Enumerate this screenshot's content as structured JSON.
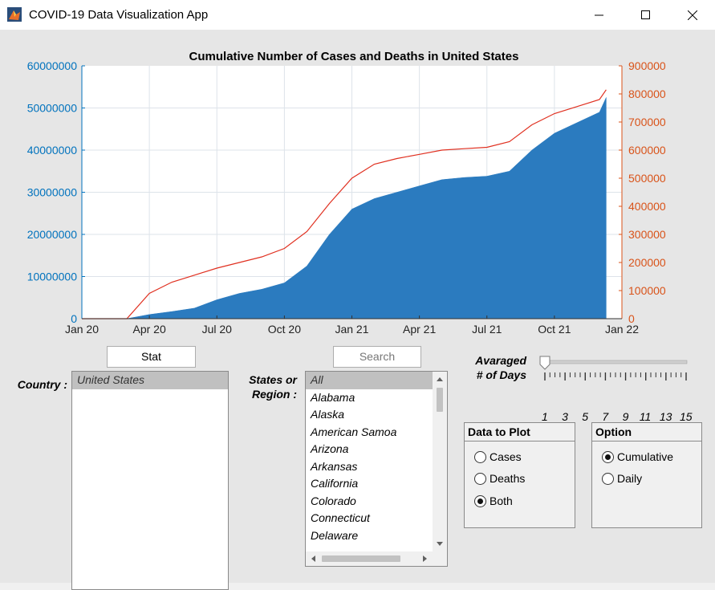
{
  "window": {
    "title": "COVID-19 Data Visualization App"
  },
  "colors": {
    "cases_bar": "#2b7bbf",
    "cases_axis": "#0072bd",
    "deaths_line": "#e03020",
    "deaths_axis": "#d95319"
  },
  "chart_data": {
    "type": "bar",
    "title": "Cumulative Number of Cases and Deaths in United States",
    "xlabel": "",
    "ylabel": "",
    "x_ticks": [
      "Jan 20",
      "Apr 20",
      "Jul 20",
      "Oct 20",
      "Jan 21",
      "Apr 21",
      "Jul 21",
      "Oct 21",
      "Jan 22"
    ],
    "y_left_ticks": [
      "0",
      "10000000",
      "20000000",
      "30000000",
      "40000000",
      "50000000",
      "60000000"
    ],
    "y_right_ticks": [
      "0",
      "100000",
      "200000",
      "300000",
      "400000",
      "500000",
      "600000",
      "700000",
      "800000",
      "900000"
    ],
    "ylim_left": [
      0,
      60000000
    ],
    "ylim_right": [
      0,
      900000
    ],
    "grid": true,
    "x_months_since": [
      0,
      2,
      3,
      4,
      5,
      6,
      7,
      8,
      9,
      10,
      11,
      12,
      13,
      14,
      15,
      16,
      17,
      18,
      19,
      20,
      21,
      22,
      23,
      23.3
    ],
    "series": [
      {
        "name": "Cases",
        "axis": "left",
        "values": [
          0,
          0,
          1000000,
          1700000,
          2500000,
          4500000,
          6000000,
          7000000,
          8500000,
          12500000,
          20000000,
          26000000,
          28500000,
          30000000,
          31500000,
          33000000,
          33500000,
          33800000,
          35000000,
          40000000,
          44000000,
          46500000,
          49000000,
          52500000
        ]
      },
      {
        "name": "Deaths",
        "axis": "right",
        "values": [
          0,
          0,
          90000,
          130000,
          155000,
          180000,
          200000,
          220000,
          250000,
          310000,
          410000,
          500000,
          550000,
          570000,
          585000,
          600000,
          605000,
          610000,
          630000,
          690000,
          730000,
          755000,
          780000,
          815000
        ]
      }
    ]
  },
  "controls": {
    "stat_button": "Stat",
    "search_button": "Search",
    "country_label": "Country :",
    "states_label_line1": "States or",
    "states_label_line2": "Region :",
    "avg_label_line1": "Avaraged",
    "avg_label_line2": "# of Days",
    "slider_ticks": [
      "1",
      "3",
      "5",
      "7",
      "9",
      "11",
      "13",
      "15"
    ],
    "slider_value": 1
  },
  "countries": [
    "United States"
  ],
  "states": [
    "All",
    "Alabama",
    "Alaska",
    "American Samoa",
    "Arizona",
    "Arkansas",
    "California",
    "Colorado",
    "Connecticut",
    "Delaware"
  ],
  "data_to_plot": {
    "title": "Data to Plot",
    "options": [
      "Cases",
      "Deaths",
      "Both"
    ],
    "selected": "Both"
  },
  "option_panel": {
    "title": "Option",
    "options": [
      "Cumulative",
      "Daily"
    ],
    "selected": "Cumulative"
  }
}
